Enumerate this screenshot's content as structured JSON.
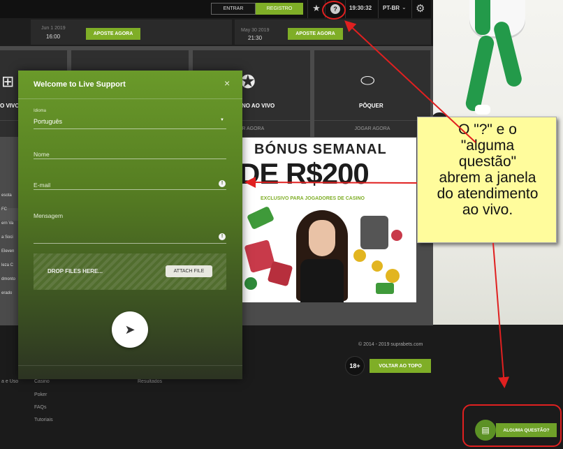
{
  "nav": {
    "login_label": "ENTRAR",
    "register_label": "REGISTRO",
    "favorites_icon": "star-icon",
    "help_icon": "question-circle-icon",
    "help_glyph": "?",
    "clock": "19:30:32",
    "language": "PT-BR",
    "settings_icon": "gear-icon"
  },
  "matches": [
    {
      "date": "Jun 1 2019",
      "time": "16:00",
      "bet_label": "APOSTE AGORA"
    },
    {
      "date": "May 30 2019",
      "time": "21:30",
      "bet_label": "APOSTE AGORA"
    }
  ],
  "categories": [
    {
      "title": "O VIVO",
      "cta": "JAR AGORA"
    },
    {
      "title": "",
      "cta": ""
    },
    {
      "title": "NO AO VIVO",
      "cta": "AR AGORA"
    },
    {
      "title": "PÔQUER",
      "cta": "JOGAR AGORA"
    }
  ],
  "sidebar_teams": [
    "esota",
    "FC",
    "ern Va",
    "a Soci",
    "Eleven",
    "leza C",
    "dmonto",
    "erado"
  ],
  "banner": {
    "line1": "BÓNUS SEMANAL",
    "line2": "DE R$200",
    "subtitle": "EXCLUSIVO PARA JOGADORES DE CASINO"
  },
  "support_form": {
    "title": "Welcome to Live Support",
    "close_glyph": "×",
    "language_label": "Idioma",
    "language_value": "Português",
    "name_placeholder": "Nome",
    "email_placeholder": "E-mail",
    "message_label": "Mensagem",
    "drop_label": "DROP FILES HERE...",
    "attach_label": "ATTACH FILE",
    "info_glyph": "!"
  },
  "footer": {
    "copyright": "© 2014 - 2019 suprabets.com",
    "age_badge": "18+",
    "back_to_top": "VOLTAR AO TOPO",
    "links_col1": [
      "Casino",
      "Poker",
      "FAQs",
      "Tutoriais"
    ],
    "links_col2": [
      "Resultados"
    ],
    "links_col0": [
      "a e Uso"
    ]
  },
  "chat_launcher": {
    "label": "ALGUMA QUESTÃO?",
    "icon": "chat-bubble-icon"
  },
  "annotation": {
    "callout_text": "O \"?\" e o\n\"alguma\nquestão\"\nabrem a janela\ndo atendimento\nao vivo.",
    "color": "#e02020"
  },
  "colors": {
    "accent_green": "#7fae27",
    "panel_green": "#6a9a2a",
    "callout_yellow": "#fffc9c"
  }
}
